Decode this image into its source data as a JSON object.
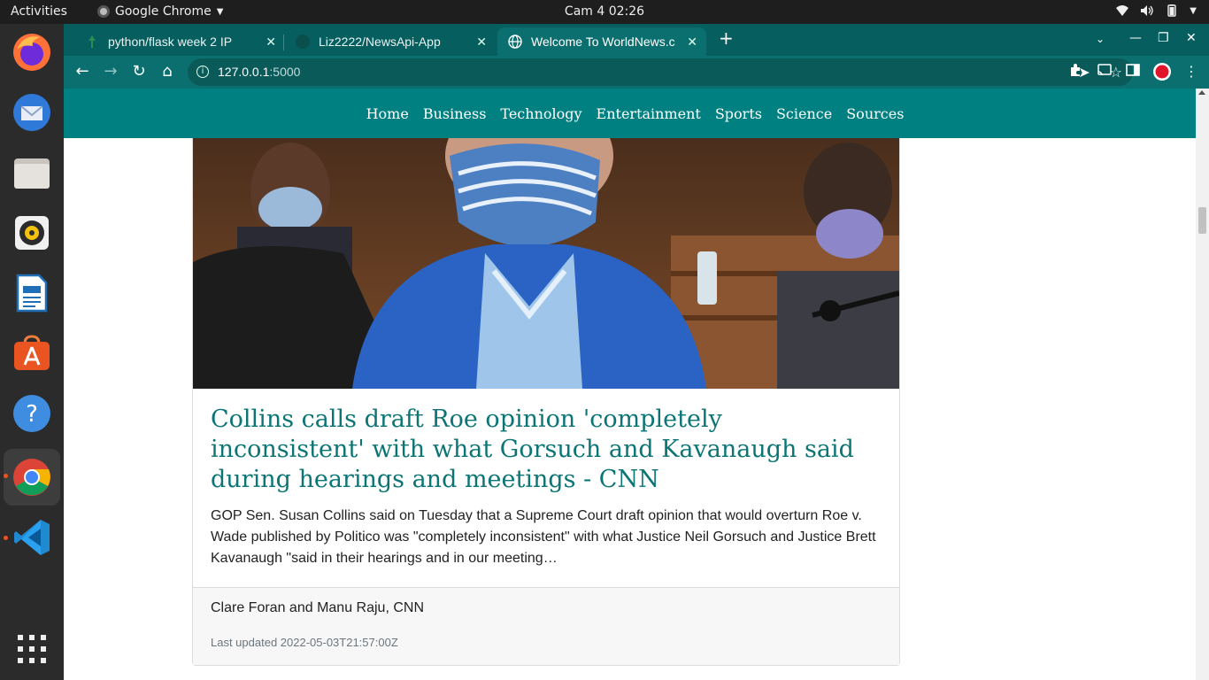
{
  "topbar": {
    "activities": "Activities",
    "app_name": "Google Chrome",
    "clock": "Cam 4  02:26"
  },
  "dock": {
    "items": [
      "firefox-icon",
      "thunderbird-icon",
      "files-icon",
      "rhythmbox-icon",
      "writer-icon",
      "software-icon",
      "help-icon",
      "chrome-icon",
      "vscode-icon",
      "app-grid-icon"
    ]
  },
  "tabs": [
    {
      "title": "python/flask week 2 IP"
    },
    {
      "title": "Liz2222/NewsApi-App"
    },
    {
      "title": "Welcome To WorldNews.c"
    }
  ],
  "address_bar": {
    "host": "127.0.0.1",
    "port": ":5000"
  },
  "nav": {
    "items": [
      "Home",
      "Business",
      "Technology",
      "Entertainment",
      "Sports",
      "Science",
      "Sources"
    ]
  },
  "article": {
    "title": "Collins calls draft Roe opinion 'completely inconsistent' with what Gorsuch and Kavanaugh said during hearings and meetings - CNN",
    "description": "GOP Sen. Susan Collins said on Tuesday that a Supreme Court draft opinion that would overturn Roe v. Wade published by Politico was \"completely inconsistent\" with what Justice Neil Gorsuch and Justice Brett Kavanaugh \"said in their hearings and in our meeting…",
    "author": "Clare Foran and Manu Raju, CNN",
    "updated": "Last updated 2022-05-03T21:57:00Z"
  },
  "colors": {
    "theme": "#008080",
    "title": "#0b7575"
  }
}
